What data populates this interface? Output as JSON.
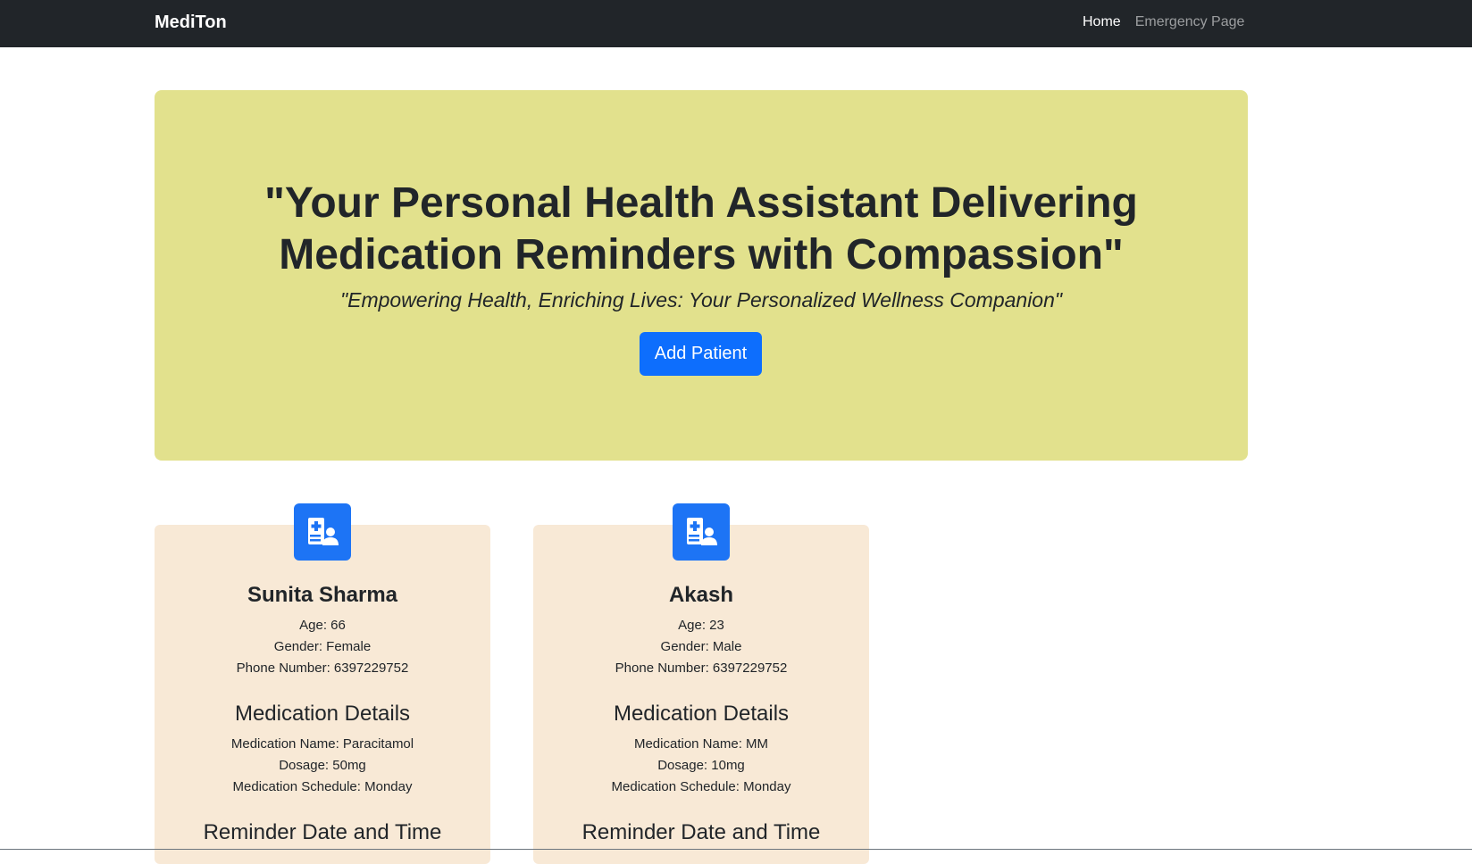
{
  "navbar": {
    "brand": "MediTon",
    "links": [
      "Home",
      "Emergency Page"
    ]
  },
  "hero": {
    "title_line1": "\"Your Personal Health Assistant Delivering",
    "title_line2": "Medication Reminders with Compassion\"",
    "subtitle": "\"Empowering Health, Enriching Lives: Your Personalized Wellness Companion\"",
    "button_label": "Add Patient"
  },
  "colors": {
    "navbar_bg": "#212529",
    "hero_bg": "#e2e18d",
    "card_bg": "#f8e9d6",
    "primary": "#0d6efd"
  },
  "patients": [
    {
      "icon": "patient-card-icon",
      "name": "Sunita Sharma",
      "age": "Age: 66",
      "gender": "Gender: Female",
      "phone": "Phone Number: 6397229752",
      "medication_title": "Medication Details",
      "medication_name": "Medication Name: Paracitamol",
      "dosage": "Dosage: 50mg",
      "schedule": "Medication Schedule: Monday",
      "reminder_title": "Reminder Date and Time"
    },
    {
      "icon": "patient-card-icon",
      "name": "Akash",
      "age": "Age: 23",
      "gender": "Gender: Male",
      "phone": "Phone Number: 6397229752",
      "medication_title": "Medication Details",
      "medication_name": "Medication Name: MM",
      "dosage": "Dosage: 10mg",
      "schedule": "Medication Schedule: Monday",
      "reminder_title": "Reminder Date and Time"
    }
  ]
}
